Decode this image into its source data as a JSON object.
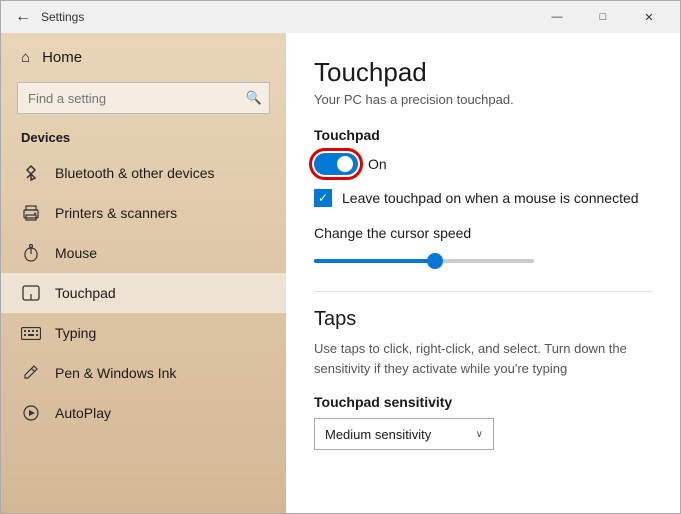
{
  "window": {
    "title": "Settings",
    "back_icon": "←",
    "min_btn": "—",
    "max_btn": "□",
    "close_btn": "✕"
  },
  "sidebar": {
    "home_label": "Home",
    "search_placeholder": "Find a setting",
    "search_icon": "🔍",
    "section_title": "Devices",
    "items": [
      {
        "id": "bluetooth",
        "label": "Bluetooth & other devices",
        "icon": "bluetooth"
      },
      {
        "id": "printers",
        "label": "Printers & scanners",
        "icon": "printer"
      },
      {
        "id": "mouse",
        "label": "Mouse",
        "icon": "mouse"
      },
      {
        "id": "touchpad",
        "label": "Touchpad",
        "icon": "touchpad",
        "active": true
      },
      {
        "id": "typing",
        "label": "Typing",
        "icon": "keyboard"
      },
      {
        "id": "pen",
        "label": "Pen & Windows Ink",
        "icon": "pen"
      },
      {
        "id": "autoplay",
        "label": "AutoPlay",
        "icon": "autoplay"
      }
    ]
  },
  "content": {
    "title": "Touchpad",
    "subtitle": "Your PC has a precision touchpad.",
    "touchpad_section_label": "Touchpad",
    "toggle_state": "On",
    "checkbox_label": "Leave touchpad on when a mouse is connected",
    "slider_label": "Change the cursor speed",
    "taps_title": "Taps",
    "taps_description": "Use taps to click, right-click, and select. Turn down the sensitivity if they activate while you're typing",
    "sensitivity_label": "Touchpad sensitivity",
    "sensitivity_value": "Medium sensitivity",
    "sensitivity_arrow": "∨"
  }
}
